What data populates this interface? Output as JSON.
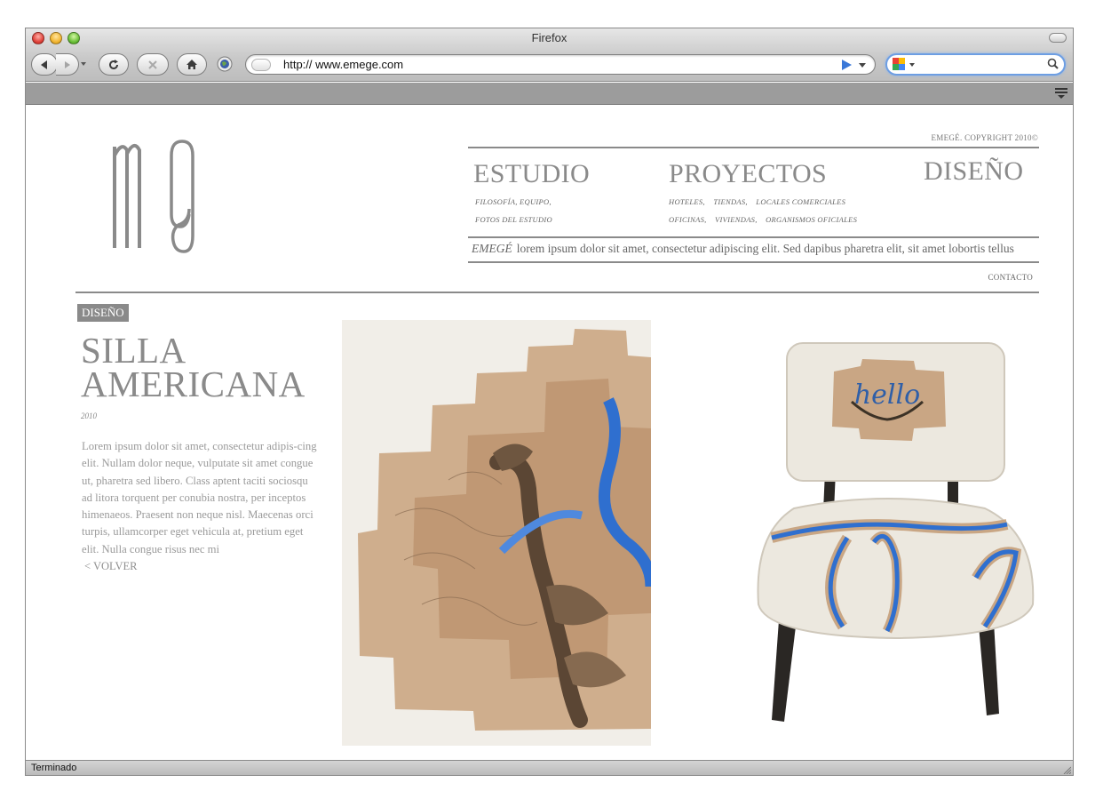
{
  "browser": {
    "window_title": "Firefox",
    "url": "http:// www.emege.com",
    "search_placeholder": "",
    "status_text": "Terminado",
    "icons": [
      "back-icon",
      "forward-icon",
      "reload-icon",
      "stop-icon",
      "home-icon",
      "globe-icon",
      "page-icon",
      "go-arrow-icon",
      "google-icon",
      "search-icon",
      "bookmarks-menu-icon"
    ]
  },
  "site": {
    "copyright": "EMEGÉ. COPYRIGHT 2010©",
    "nav": {
      "estudio": {
        "label": "ESTUDIO",
        "sub_row1": [
          "FILOSOFÍA, EQUIPO,"
        ],
        "sub_row2": [
          "FOTOS DEL ESTUDIO"
        ]
      },
      "proyectos": {
        "label": "PROYECTOS",
        "sub_row1": [
          "HOTELES,",
          "TIENDAS,",
          "LOCALES COMERCIALES"
        ],
        "sub_row2": [
          "OFICINAS,",
          "VIVIENDAS,",
          "ORGANISMOS OFICIALES"
        ]
      },
      "diseno": {
        "label": "DISEÑO"
      }
    },
    "tagline_brand": "EMEGÉ",
    "tagline_text": "lorem ipsum dolor sit amet, consectetur adipiscing elit. Sed dapibus pharetra elit, sit amet lobortis tellus",
    "contacto": "CONTACTO"
  },
  "article": {
    "category": "DISEÑO",
    "title_line1": "SILLA",
    "title_line2": "AMERICANA",
    "year": "2010",
    "description": "Lorem ipsum dolor sit amet, consectetur adipis-cing elit. Nullam dolor neque, vulputate sit amet congue ut, pharetra sed libero. Class aptent taciti sociosqu ad litora torquent per conubia nostra, per inceptos himenaeos. Praesent non neque nisl. Maecenas orci turpis, ullamcorper eget vehicula at, pretium eget elit. Nulla congue risus nec mi",
    "back_link": "< VOLVER",
    "chair_back_word": "hello"
  },
  "colors": {
    "brand_gray": "#8a8a8a",
    "canvas_beige": "#f2eee6",
    "paint_tan": "#c9a684",
    "ribbon_blue": "#2f6fcf",
    "upholstery": "#ece8df"
  }
}
